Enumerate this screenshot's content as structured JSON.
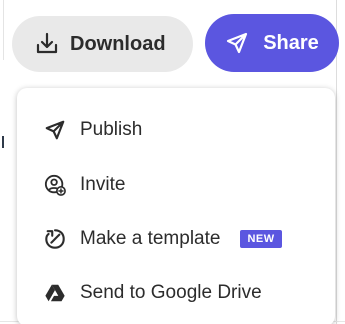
{
  "toolbar": {
    "download_label": "Download",
    "share_label": "Share",
    "download_icon": "download-icon",
    "share_icon": "paper-plane-icon"
  },
  "menu": {
    "items": [
      {
        "label": "Publish",
        "icon": "paper-plane-icon"
      },
      {
        "label": "Invite",
        "icon": "add-user-icon"
      },
      {
        "label": "Make a template",
        "icon": "template-icon",
        "badge": "NEW"
      },
      {
        "label": "Send to Google Drive",
        "icon": "google-drive-icon"
      }
    ]
  },
  "colors": {
    "accent": "#5b56e0",
    "button_gray": "#e9e9e9",
    "text": "#2c2c2c"
  }
}
